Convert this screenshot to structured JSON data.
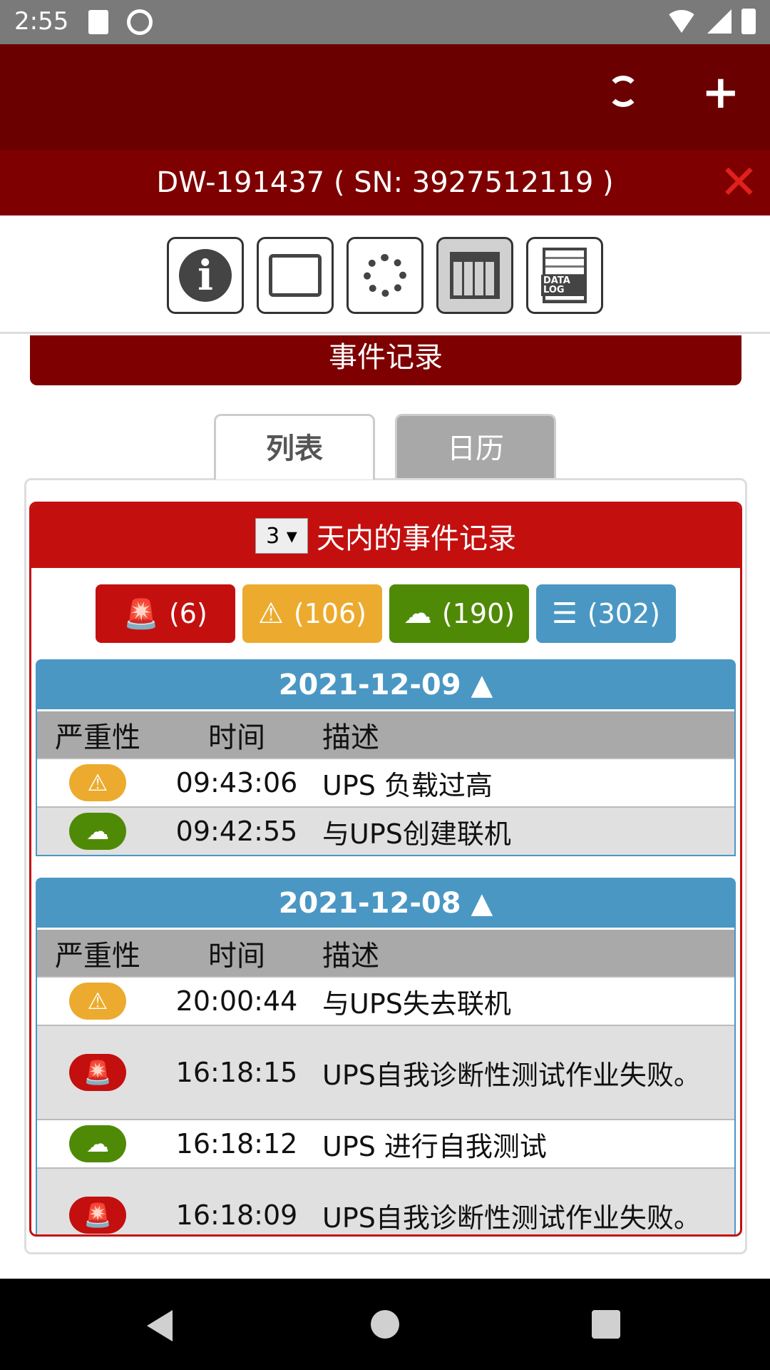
{
  "status_bar": {
    "time": "2:55"
  },
  "device": {
    "title": "DW-191437 ( SN: 3927512119 )",
    "close_glyph": "✕"
  },
  "toolbar_icons": [
    "info-icon",
    "monitor-icon",
    "settings-icon",
    "event-calendar-icon",
    "data-log-icon"
  ],
  "data_log_label": "DATA LOG",
  "section_title": "事件记录",
  "tabs": {
    "list": "列表",
    "calendar": "日历"
  },
  "events_header": {
    "days": "3 ▾",
    "label": "天内的事件记录"
  },
  "filters": {
    "critical": "(6)",
    "warning": "(106)",
    "info": "(190)",
    "all": "(302)"
  },
  "columns": {
    "severity": "严重性",
    "time": "时间",
    "description": "描述"
  },
  "days": [
    {
      "date": "2021-12-09 ▲",
      "rows": [
        {
          "severity": "warning",
          "time": "09:43:06",
          "desc": "UPS 负载过高"
        },
        {
          "severity": "info",
          "time": "09:42:55",
          "desc": "与UPS创建联机"
        }
      ]
    },
    {
      "date": "2021-12-08 ▲",
      "rows": [
        {
          "severity": "warning",
          "time": "20:00:44",
          "desc": "与UPS失去联机"
        },
        {
          "severity": "critical",
          "time": "16:18:15",
          "desc": "UPS自我诊断性测试作业失败。"
        },
        {
          "severity": "info",
          "time": "16:18:12",
          "desc": "UPS 进行自我测试"
        },
        {
          "severity": "critical",
          "time": "16:18:09",
          "desc": "UPS自我诊断性测试作业失败。"
        }
      ]
    }
  ],
  "colors": {
    "dark_red": "#6b0000",
    "red": "#c40f0f",
    "yellow": "#ecab2e",
    "green": "#4f8a06",
    "blue": "#4a97c3"
  }
}
